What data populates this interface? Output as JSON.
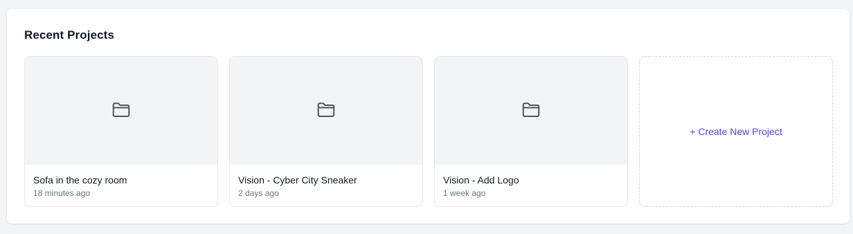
{
  "section": {
    "title": "Recent Projects"
  },
  "projects": [
    {
      "name": "Sofa in the cozy room",
      "time": "18 minutes ago",
      "icon": "folder-icon"
    },
    {
      "name": "Vision - Cyber City Sneaker",
      "time": "2 days ago",
      "icon": "folder-icon"
    },
    {
      "name": "Vision - Add Logo",
      "time": "1 week ago",
      "icon": "folder-icon"
    }
  ],
  "create": {
    "label": "+ Create New Project"
  },
  "colors": {
    "accent": "#4f46e5",
    "thumb_bg": "#f3f4f6",
    "page_bg": "#f3f4f6",
    "icon": "#4b5563"
  }
}
